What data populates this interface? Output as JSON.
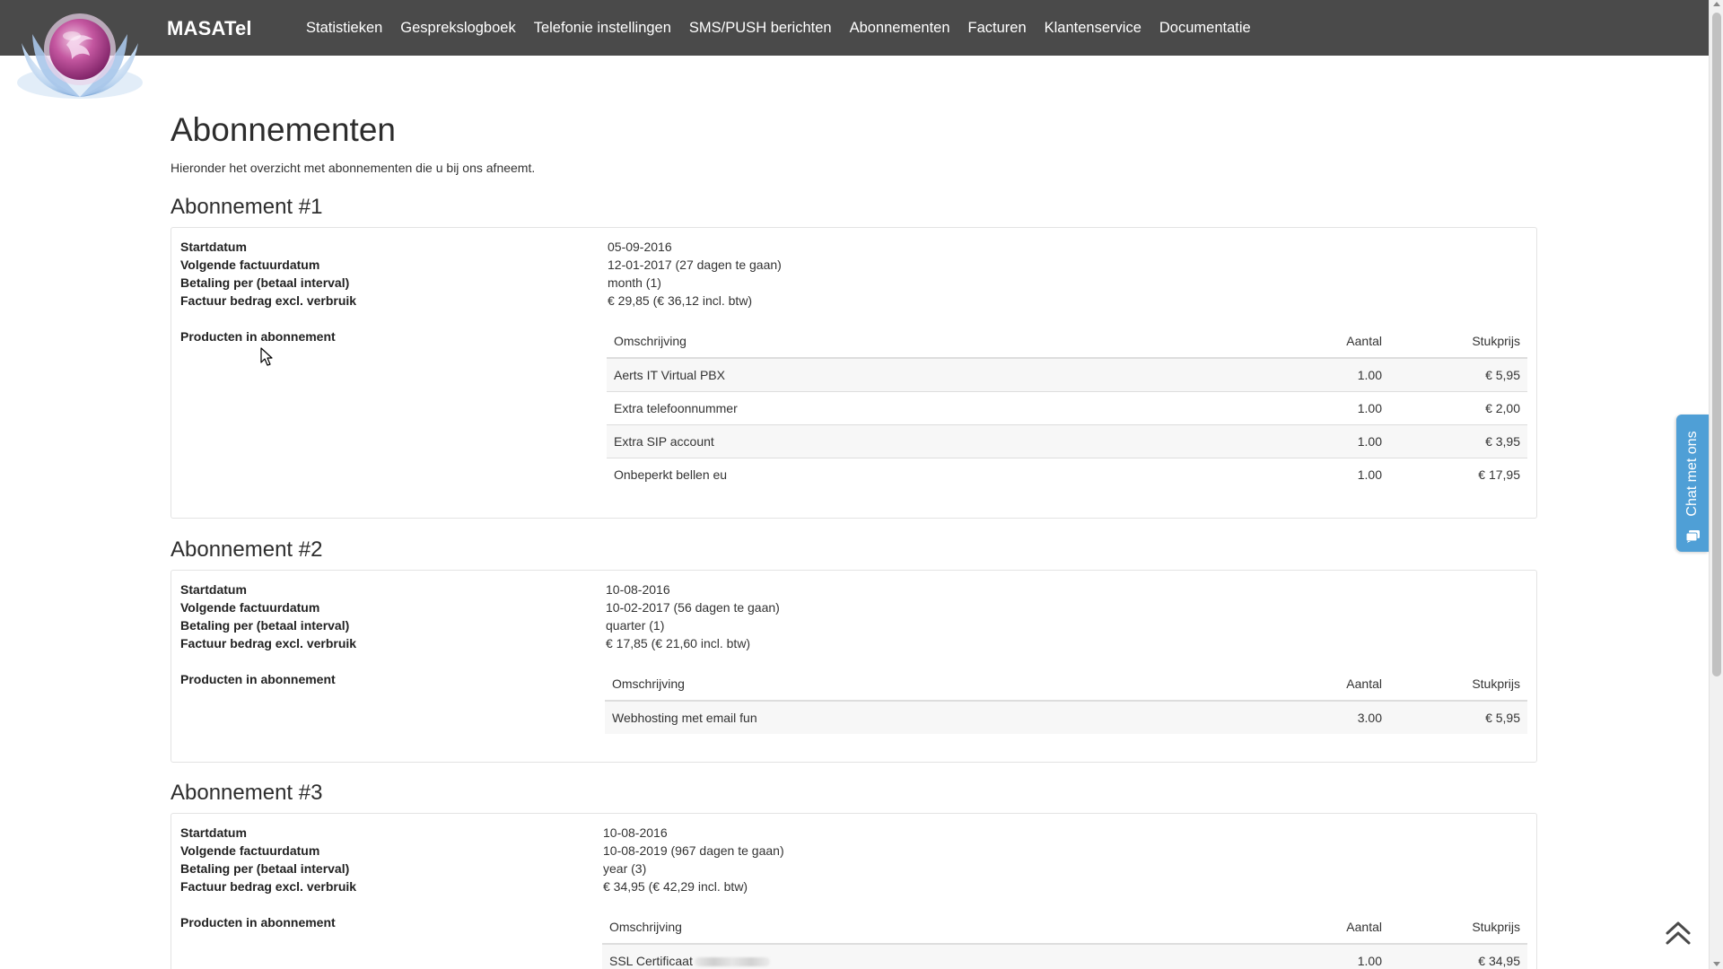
{
  "app": {
    "brand": "MASATel"
  },
  "nav": {
    "items": [
      {
        "label": "Statistieken"
      },
      {
        "label": "Gesprekslogboek"
      },
      {
        "label": "Telefonie instellingen"
      },
      {
        "label": "SMS/PUSH berichten"
      },
      {
        "label": "Abonnementen"
      },
      {
        "label": "Facturen"
      },
      {
        "label": "Klantenservice"
      },
      {
        "label": "Documentatie"
      }
    ]
  },
  "page": {
    "title": "Abonnementen",
    "intro": "Hieronder het overzicht met abonnementen die u bij ons afneemt."
  },
  "labels": {
    "start": "Startdatum",
    "next_invoice": "Volgende factuurdatum",
    "interval": "Betaling per (betaal interval)",
    "amount": "Factuur bedrag excl. verbruik",
    "products": "Producten in abonnement",
    "col_desc": "Omschrijving",
    "col_qty": "Aantal",
    "col_price": "Stukprijs"
  },
  "subscriptions": [
    {
      "heading": "Abonnement #1",
      "start": "05-09-2016",
      "next_invoice": "12-01-2017 (27 dagen te gaan)",
      "interval": "month (1)",
      "amount": "€ 29,85 (€ 36,12 incl. btw)",
      "products": [
        {
          "desc": "Aerts IT Virtual PBX",
          "qty": "1.00",
          "price": "€ 5,95"
        },
        {
          "desc": "Extra telefoonnummer",
          "qty": "1.00",
          "price": "€ 2,00"
        },
        {
          "desc": "Extra SIP account",
          "qty": "1.00",
          "price": "€ 3,95"
        },
        {
          "desc": "Onbeperkt bellen eu",
          "qty": "1.00",
          "price": "€ 17,95"
        }
      ]
    },
    {
      "heading": "Abonnement #2",
      "start": "10-08-2016",
      "next_invoice": "10-02-2017 (56 dagen te gaan)",
      "interval": "quarter (1)",
      "amount": "€ 17,85 (€ 21,60 incl. btw)",
      "products": [
        {
          "desc": "Webhosting met email fun",
          "qty": "3.00",
          "price": "€ 5,95"
        }
      ]
    },
    {
      "heading": "Abonnement #3",
      "start": "10-08-2016",
      "next_invoice": "10-08-2019 (967 dagen te gaan)",
      "interval": "year (3)",
      "amount": "€ 34,95 (€ 42,29 incl. btw)",
      "products": [
        {
          "desc": "SSL Certificaat",
          "qty": "1.00",
          "price": "€ 34,95"
        }
      ]
    }
  ],
  "chat": {
    "label": "Chat met ons"
  },
  "colors": {
    "navbar": "#4a4a4a",
    "chat": "#4f9fd6",
    "logo_center": "#b0407e"
  }
}
